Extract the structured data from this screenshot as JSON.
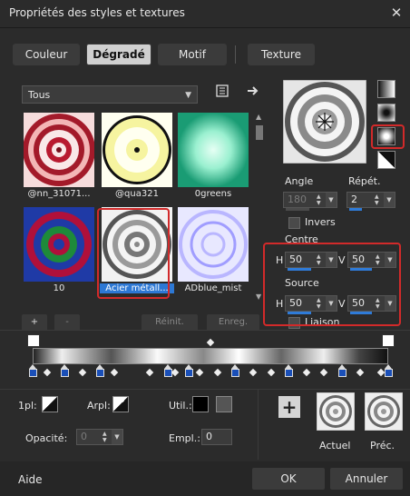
{
  "window": {
    "title": "Propriétés des styles et textures",
    "close": "✕"
  },
  "tabs": [
    {
      "label": "Couleur"
    },
    {
      "label": "Dégradé",
      "active": true
    },
    {
      "label": "Motif"
    },
    {
      "label": "Texture"
    }
  ],
  "preset_filter": {
    "value": "Tous"
  },
  "gallery": [
    {
      "label": "@nn_31071...",
      "colors": [
        "#a31a2a",
        "#f3b6b6",
        "#f9e8e8"
      ]
    },
    {
      "label": "@qua321",
      "colors": [
        "#111111",
        "#f6f4a0",
        "#fffff0"
      ]
    },
    {
      "label": "0greens",
      "colors": [
        "#1a9c74",
        "#9af0d0",
        "#e6fff4"
      ]
    },
    {
      "label": "10",
      "colors": [
        "#1f3aa6",
        "#b0103a",
        "#1e8a3a"
      ]
    },
    {
      "label": "Acier métall...",
      "colors": [
        "#555555",
        "#f4f4f4",
        "#bdbdbd"
      ],
      "selected": true
    },
    {
      "label": "ADblue_mist",
      "colors": [
        "#7a78d8",
        "#e8e8ff",
        "#b9b6ff"
      ]
    }
  ],
  "gallery_buttons": {
    "add": "+",
    "remove": "-",
    "reset": "Réinit.",
    "save": "Enreg."
  },
  "angle": {
    "label": "Angle",
    "value": "180"
  },
  "repeat": {
    "label": "Répét.",
    "value": "2"
  },
  "invert": {
    "label": "Invers"
  },
  "center": {
    "label": "Centre",
    "h_label": "H",
    "h_value": "50",
    "v_label": "V",
    "v_value": "50"
  },
  "source": {
    "label": "Source",
    "h_label": "H",
    "h_value": "50",
    "v_label": "V",
    "v_value": "50"
  },
  "link": {
    "label": "Liaison"
  },
  "stops": {
    "markers": [
      0.0,
      0.09,
      0.19,
      0.38,
      0.44,
      0.57,
      0.72,
      0.87,
      1.0
    ],
    "midpoints": [
      0.04,
      0.14,
      0.23,
      0.33,
      0.4,
      0.47,
      0.52,
      0.62,
      0.67,
      0.77,
      0.82,
      0.92,
      0.98
    ]
  },
  "fields": {
    "first_plan_label": "1pl:",
    "back_plan_label": "Arpl:",
    "user_label": "Util.:",
    "opacity_label": "Opacité:",
    "opacity_value": "0",
    "location_label": "Empl.:",
    "location_value": "0"
  },
  "preview": {
    "current_label": "Actuel",
    "previous_label": "Préc."
  },
  "footer": {
    "help": "Aide",
    "ok": "OK",
    "cancel": "Annuler"
  },
  "colors": {
    "accent": "#2f7bd8",
    "highlight_box": "#d22a2a"
  }
}
